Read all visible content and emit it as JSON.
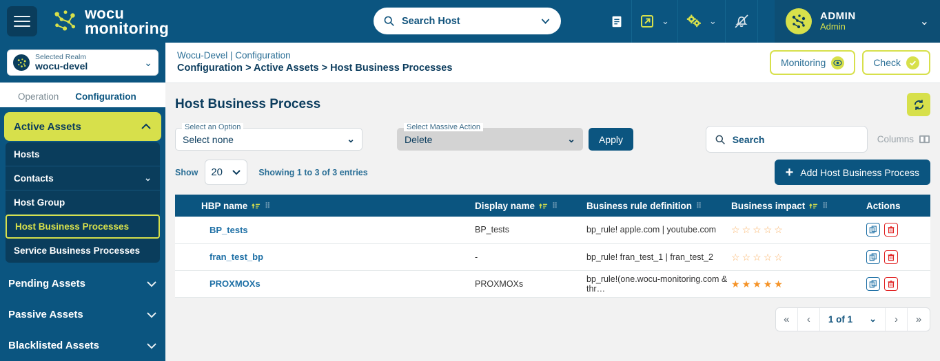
{
  "topbar": {
    "hamburger_name": "menu-toggle",
    "brand_line1": "wocu",
    "brand_line2": "monitoring",
    "host_search_placeholder": "Search Host",
    "icons": [
      "book-icon",
      "external-link-icon",
      "gears-icon",
      "bell-off-icon"
    ],
    "user_name": "ADMIN",
    "user_role": "Admin"
  },
  "sidebar": {
    "realm_label": "Selected Realm",
    "realm_value": "wocu-devel",
    "tabs": [
      {
        "label": "Operation",
        "active": false
      },
      {
        "label": "Configuration",
        "active": true
      }
    ],
    "group": {
      "label": "Active Assets",
      "expanded": true
    },
    "subitems": [
      {
        "label": "Hosts",
        "chevron": false,
        "selected": false
      },
      {
        "label": "Contacts",
        "chevron": true,
        "selected": false
      },
      {
        "label": "Host Group",
        "chevron": false,
        "selected": false
      },
      {
        "label": "Host Business Processes",
        "chevron": false,
        "selected": true
      },
      {
        "label": "Service Business Processes",
        "chevron": false,
        "selected": false
      }
    ],
    "groups": [
      {
        "label": "Pending Assets"
      },
      {
        "label": "Passive Assets"
      },
      {
        "label": "Blacklisted Assets"
      }
    ]
  },
  "breadcrumb": {
    "line1": "Wocu-Devel | Configuration",
    "line2": "Configuration > Active Assets > Host Business Processes",
    "monitoring_label": "Monitoring",
    "check_label": "Check"
  },
  "page": {
    "title": "Host Business Process",
    "refresh_name": "refresh-icon"
  },
  "toolbar": {
    "option_label": "Select an Option",
    "option_value": "Select none",
    "massive_label": "Select Massive Action",
    "massive_value": "Delete",
    "apply_label": "Apply",
    "search_placeholder": "Search",
    "columns_label": "Columns"
  },
  "showbar": {
    "show_label": "Show",
    "show_value": "20",
    "showing_text": "Showing 1 to 3 of 3 entries",
    "add_label": "Add Host Business Process"
  },
  "table": {
    "columns": [
      {
        "label": "HBP name",
        "sortable": true,
        "grip": true
      },
      {
        "label": "Display name",
        "sortable": true,
        "grip": true
      },
      {
        "label": "Business rule definition",
        "sortable": false,
        "grip": true
      },
      {
        "label": "Business impact",
        "sortable": true,
        "grip": true
      },
      {
        "label": "Actions",
        "sortable": false,
        "grip": false
      }
    ],
    "rows": [
      {
        "hbp_name": "BP_tests",
        "display_name": "BP_tests",
        "rule": "bp_rule! apple.com | youtube.com",
        "impact": 0,
        "impact_max": 5
      },
      {
        "hbp_name": "fran_test_bp",
        "display_name": "-",
        "rule": "bp_rule! fran_test_1 | fran_test_2",
        "impact": 0,
        "impact_max": 5
      },
      {
        "hbp_name": "PROXMOXs",
        "display_name": "PROXMOXs",
        "rule": "bp_rule!(one.wocu-monitoring.com & thr…",
        "impact": 5,
        "impact_max": 5
      }
    ]
  },
  "pagination": {
    "first": "«",
    "prev": "‹",
    "page_text": "1 of 1",
    "next": "›",
    "last": "»"
  },
  "colors": {
    "brand_blue": "#0b5580",
    "dark_blue": "#0a3d5c",
    "accent_lime": "#d7e04b",
    "link_blue": "#1d6fa5",
    "star_orange": "#f59327",
    "delete_red": "#e02020"
  }
}
